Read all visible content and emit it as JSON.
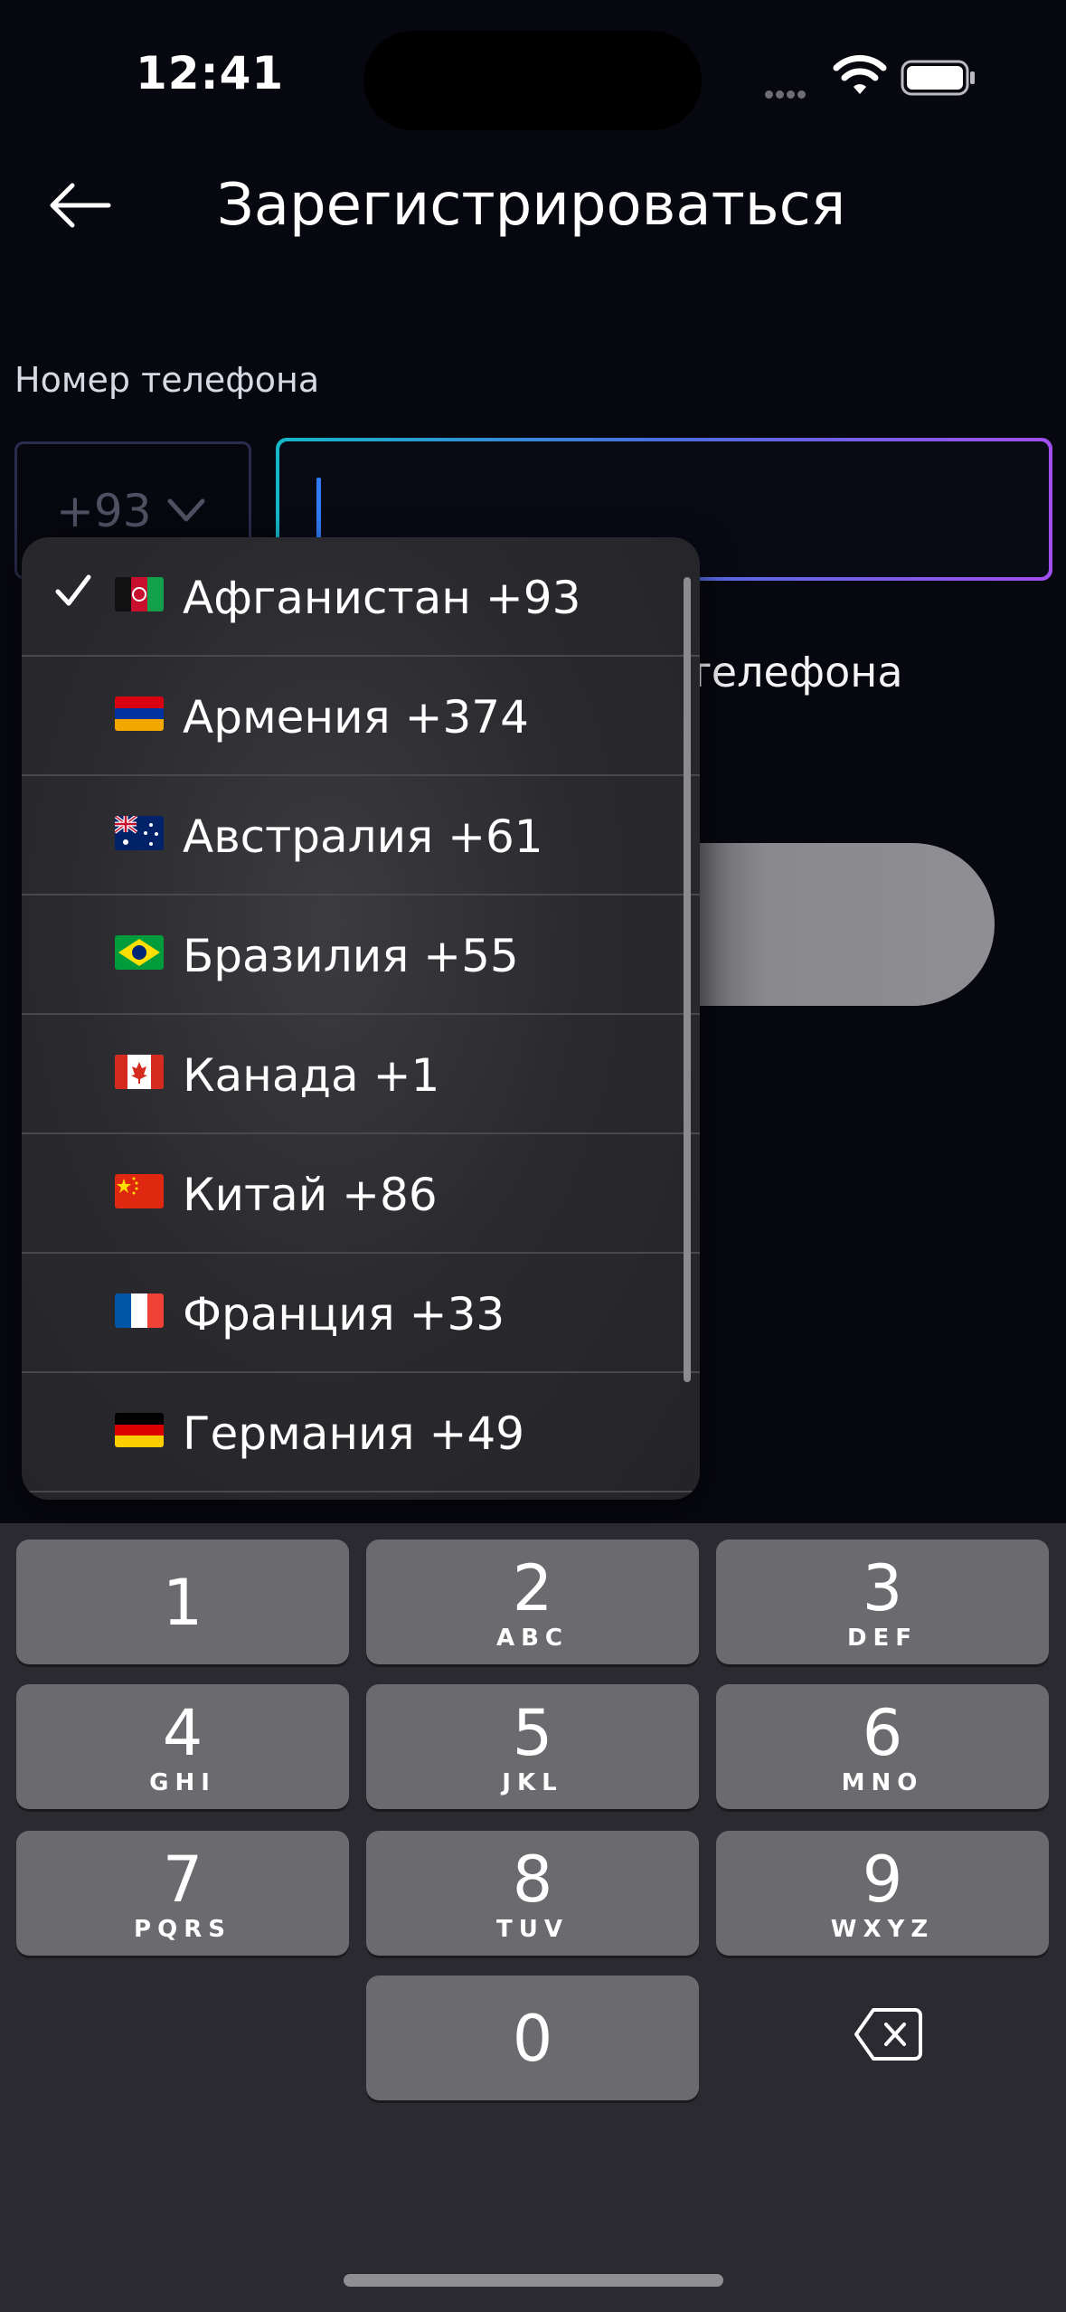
{
  "status_bar": {
    "time": "12:41"
  },
  "header": {
    "title": "Зарегистрироваться"
  },
  "form": {
    "phone_label": "Номер телефона",
    "country_code": "+93",
    "phone_value": "",
    "partial_hint": "телефона"
  },
  "dropdown": {
    "selected_index": 0,
    "items": [
      {
        "label": "Афганистан +93",
        "flag": "afghanistan-flag"
      },
      {
        "label": "Армения +374",
        "flag": "armenia-flag"
      },
      {
        "label": "Австралия +61",
        "flag": "australia-flag"
      },
      {
        "label": "Бразилия +55",
        "flag": "brazil-flag"
      },
      {
        "label": "Канада +1",
        "flag": "canada-flag"
      },
      {
        "label": "Китай +86",
        "flag": "china-flag"
      },
      {
        "label": "Франция +33",
        "flag": "france-flag"
      },
      {
        "label": "Германия +49",
        "flag": "germany-flag"
      }
    ]
  },
  "keyboard": {
    "keys": [
      {
        "num": "1",
        "letters": ""
      },
      {
        "num": "2",
        "letters": "ABC"
      },
      {
        "num": "3",
        "letters": "DEF"
      },
      {
        "num": "4",
        "letters": "GHI"
      },
      {
        "num": "5",
        "letters": "JKL"
      },
      {
        "num": "6",
        "letters": "MNO"
      },
      {
        "num": "7",
        "letters": "PQRS"
      },
      {
        "num": "8",
        "letters": "TUV"
      },
      {
        "num": "9",
        "letters": "WXYZ"
      },
      {
        "num": "0",
        "letters": ""
      }
    ]
  },
  "colors": {
    "background": "#07080f",
    "input_gradient_start": "#14b8c9",
    "input_gradient_end": "#a24ff0",
    "caret": "#2f7cf6",
    "keyboard_bg": "#2b2a31",
    "key_bg": "#6a6a6f"
  }
}
